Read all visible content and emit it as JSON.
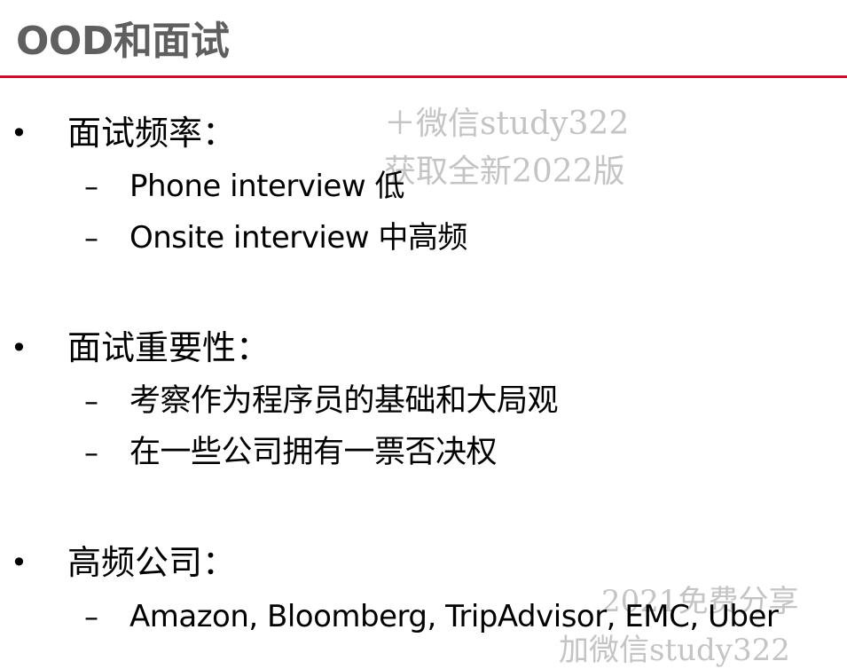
{
  "slide": {
    "title": "OOD和面试"
  },
  "sections": [
    {
      "bullet": "•",
      "heading": "面试频率：",
      "items": [
        {
          "dash": "–",
          "text": "Phone interview 低"
        },
        {
          "dash": "–",
          "text": "Onsite interview 中高频"
        }
      ]
    },
    {
      "bullet": "•",
      "heading": "面试重要性：",
      "items": [
        {
          "dash": "–",
          "text": "考察作为程序员的基础和大局观"
        },
        {
          "dash": "–",
          "text": "在一些公司拥有一票否决权"
        }
      ]
    },
    {
      "bullet": "•",
      "heading": "高频公司：",
      "items": [
        {
          "dash": "–",
          "text": "Amazon, Bloomberg, TripAdvisor, EMC, Uber"
        }
      ]
    }
  ],
  "watermarks": {
    "top_line1": "＋微信study322",
    "top_line2": "获取全新2022版",
    "bottom_line1": "2021免费分享",
    "bottom_line2": "加微信study322"
  },
  "colors": {
    "title": "#5f5f5f",
    "rule": "#c8102e",
    "watermark": "#c4c4c4",
    "text": "#000000"
  }
}
